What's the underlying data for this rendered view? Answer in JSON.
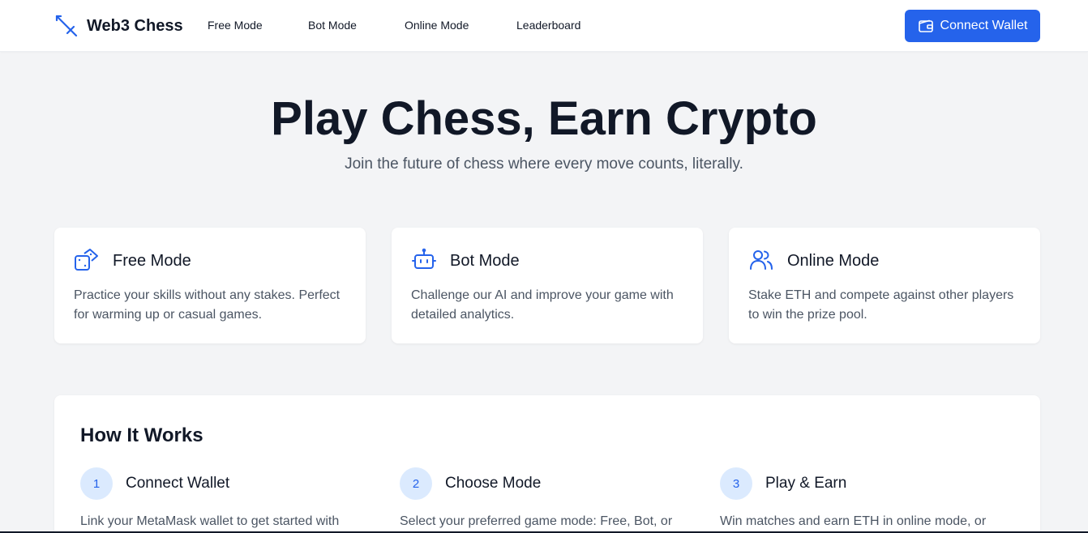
{
  "navbar": {
    "brand": "Web3 Chess",
    "brand_icon": "sword-icon",
    "links": [
      "Free Mode",
      "Bot Mode",
      "Online Mode",
      "Leaderboard"
    ],
    "connect_label": "Connect Wallet",
    "connect_icon": "wallet-icon"
  },
  "hero": {
    "title": "Play Chess, Earn Crypto",
    "subtitle": "Join the future of chess where every move counts, literally."
  },
  "modes": [
    {
      "icon": "dice-icon",
      "title": "Free Mode",
      "desc": "Practice your skills without any stakes. Perfect for warming up or casual games."
    },
    {
      "icon": "bot-icon",
      "title": "Bot Mode",
      "desc": "Challenge our AI and improve your game with detailed analytics."
    },
    {
      "icon": "users-icon",
      "title": "Online Mode",
      "desc": "Stake ETH and compete against other players to win the prize pool."
    }
  ],
  "how": {
    "title": "How It Works",
    "steps": [
      {
        "num": "1",
        "title": "Connect Wallet",
        "desc": "Link your MetaMask wallet to get started with online matches."
      },
      {
        "num": "2",
        "title": "Choose Mode",
        "desc": "Select your preferred game mode: Free, Bot, or Online with stakes."
      },
      {
        "num": "3",
        "title": "Play & Earn",
        "desc": "Win matches and earn ETH in online mode, or practice risk-free."
      }
    ]
  },
  "colors": {
    "accent": "#2563eb",
    "accent_light": "#dbeafe",
    "background": "#f3f4f6",
    "text": "#111827",
    "muted": "#4b5563"
  }
}
